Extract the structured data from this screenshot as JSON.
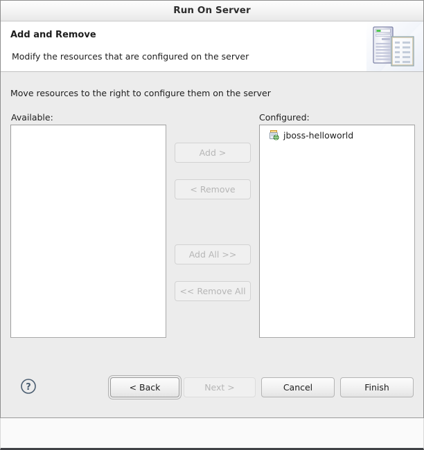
{
  "window": {
    "title": "Run On Server"
  },
  "header": {
    "title": "Add and Remove",
    "description": "Modify the resources that are configured on the server",
    "icon": "server-and-document-icon"
  },
  "main": {
    "instruction": "Move resources to the right to configure them on the server",
    "available": {
      "label": "Available:",
      "items": []
    },
    "configured": {
      "label": "Configured:",
      "items": [
        {
          "label": "jboss-helloworld",
          "icon": "deployed-module-icon"
        }
      ]
    },
    "transfer_buttons": [
      {
        "label": "Add >",
        "name": "add-button",
        "enabled": false
      },
      {
        "label": "< Remove",
        "name": "remove-button",
        "enabled": false
      },
      {
        "label": "Add All >>",
        "name": "add-all-button",
        "enabled": false
      },
      {
        "label": "<< Remove All",
        "name": "remove-all-button",
        "enabled": false
      }
    ]
  },
  "footer": {
    "help_icon": "help-question-mark-icon",
    "buttons": [
      {
        "label": "< Back",
        "name": "back-button",
        "enabled": true,
        "focused": true
      },
      {
        "label": "Next >",
        "name": "next-button",
        "enabled": false,
        "focused": false
      },
      {
        "label": "Cancel",
        "name": "cancel-button",
        "enabled": true,
        "focused": false
      },
      {
        "label": "Finish",
        "name": "finish-button",
        "enabled": true,
        "focused": false
      }
    ]
  },
  "colors": {
    "dialog_background": "#ececec",
    "header_background": "#ffffff",
    "list_background": "#ffffff",
    "text": "#1d1d1d",
    "disabled_text": "#b6b6b6",
    "border": "#a8a8a8",
    "help_icon": "#4a5d70"
  }
}
